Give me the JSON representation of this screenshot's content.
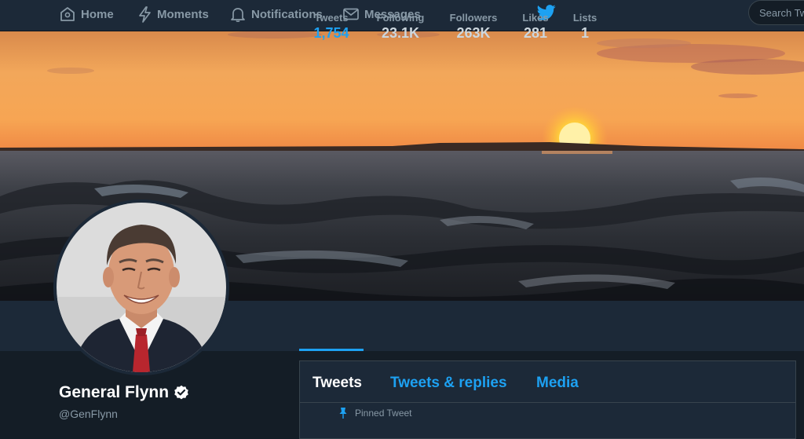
{
  "nav": {
    "items": [
      {
        "label": "Home",
        "icon": "home-icon"
      },
      {
        "label": "Moments",
        "icon": "lightning-icon"
      },
      {
        "label": "Notifications",
        "icon": "bell-icon"
      },
      {
        "label": "Messages",
        "icon": "envelope-icon"
      }
    ],
    "logo_icon": "twitter-bird-icon",
    "search_placeholder": "Search Twitter"
  },
  "profile": {
    "name": "General Flynn",
    "handle": "@GenFlynn",
    "verified_icon": "verified-badge-icon"
  },
  "stats": [
    {
      "label": "Tweets",
      "value": "1,754",
      "active": true
    },
    {
      "label": "Following",
      "value": "23.1K"
    },
    {
      "label": "Followers",
      "value": "263K"
    },
    {
      "label": "Likes",
      "value": "281"
    },
    {
      "label": "Lists",
      "value": "1"
    }
  ],
  "timeline": {
    "tabs": [
      {
        "label": "Tweets",
        "active": true
      },
      {
        "label": "Tweets & replies"
      },
      {
        "label": "Media"
      }
    ],
    "pinned_label": "Pinned Tweet",
    "pinned_icon": "pin-icon"
  },
  "colors": {
    "accent": "#1da1f2",
    "nav_bg": "#1c2938",
    "page_bg": "#141d26",
    "muted_text": "#8899a6"
  }
}
